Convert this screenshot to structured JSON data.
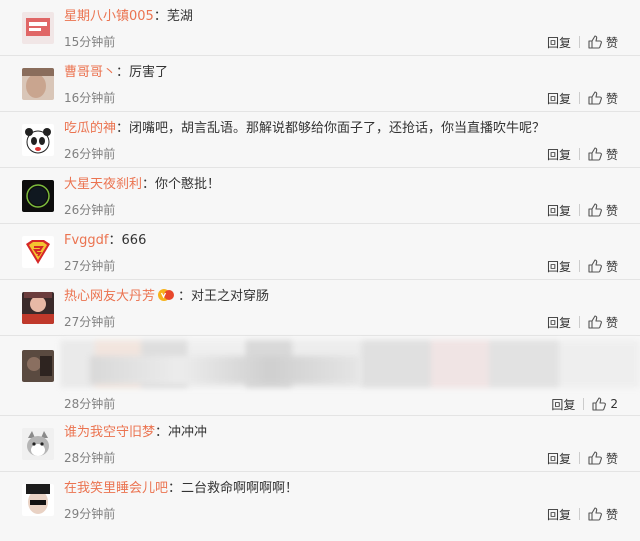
{
  "actions": {
    "reply_label": "回复",
    "like_label": "赞"
  },
  "comments": [
    {
      "username": "星期八小镇005",
      "separator": "：",
      "content": "芜湖",
      "time": "15分钟前",
      "like": "赞"
    },
    {
      "username": "曹哥哥丶",
      "separator": "：",
      "content": "厉害了",
      "time": "16分钟前",
      "like": "赞"
    },
    {
      "username": "吃瓜的神",
      "separator": "：",
      "content": "闭嘴吧，胡言乱语。那解说都够给你面子了，还抢话，你当直播吹牛呢？",
      "time": "26分钟前",
      "like": "赞"
    },
    {
      "username": "大星天夜刹利",
      "separator": "：",
      "content": "你个憨批！",
      "time": "26分钟前",
      "like": "赞"
    },
    {
      "username": "Fvggdf",
      "separator": "：",
      "content": "666",
      "time": "27分钟前",
      "like": "赞"
    },
    {
      "username": "热心网友大丹芳",
      "separator": "：",
      "content": "对王之对穿肠",
      "time": "27分钟前",
      "like": "赞"
    },
    {
      "username": "",
      "separator": "",
      "content": "",
      "time": "28分钟前",
      "like": "2"
    },
    {
      "username": "谁为我空守旧梦",
      "separator": "：",
      "content": "冲冲冲",
      "time": "28分钟前",
      "like": "赞"
    },
    {
      "username": "在我笑里睡会儿吧",
      "separator": "：",
      "content": "二台救命啊啊啊啊！",
      "time": "29分钟前",
      "like": "赞"
    }
  ]
}
